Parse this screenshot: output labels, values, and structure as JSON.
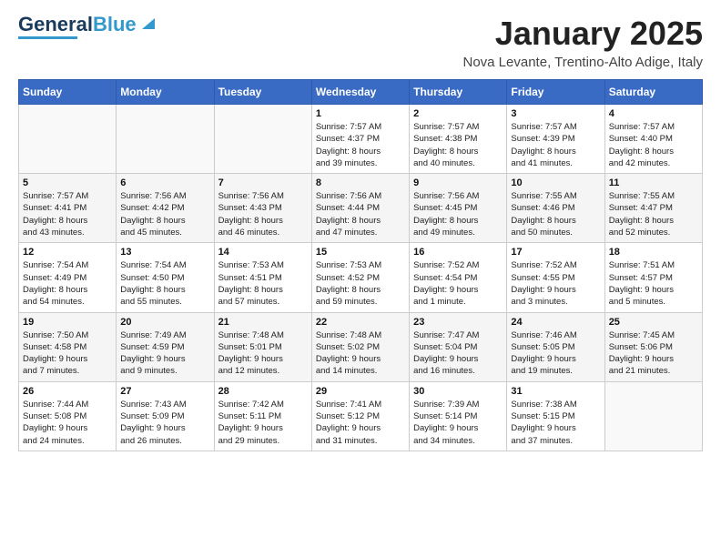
{
  "header": {
    "logo_line1": "General",
    "logo_line2": "Blue",
    "month": "January 2025",
    "location": "Nova Levante, Trentino-Alto Adige, Italy"
  },
  "weekdays": [
    "Sunday",
    "Monday",
    "Tuesday",
    "Wednesday",
    "Thursday",
    "Friday",
    "Saturday"
  ],
  "weeks": [
    [
      {
        "day": "",
        "info": ""
      },
      {
        "day": "",
        "info": ""
      },
      {
        "day": "",
        "info": ""
      },
      {
        "day": "1",
        "info": "Sunrise: 7:57 AM\nSunset: 4:37 PM\nDaylight: 8 hours\nand 39 minutes."
      },
      {
        "day": "2",
        "info": "Sunrise: 7:57 AM\nSunset: 4:38 PM\nDaylight: 8 hours\nand 40 minutes."
      },
      {
        "day": "3",
        "info": "Sunrise: 7:57 AM\nSunset: 4:39 PM\nDaylight: 8 hours\nand 41 minutes."
      },
      {
        "day": "4",
        "info": "Sunrise: 7:57 AM\nSunset: 4:40 PM\nDaylight: 8 hours\nand 42 minutes."
      }
    ],
    [
      {
        "day": "5",
        "info": "Sunrise: 7:57 AM\nSunset: 4:41 PM\nDaylight: 8 hours\nand 43 minutes."
      },
      {
        "day": "6",
        "info": "Sunrise: 7:56 AM\nSunset: 4:42 PM\nDaylight: 8 hours\nand 45 minutes."
      },
      {
        "day": "7",
        "info": "Sunrise: 7:56 AM\nSunset: 4:43 PM\nDaylight: 8 hours\nand 46 minutes."
      },
      {
        "day": "8",
        "info": "Sunrise: 7:56 AM\nSunset: 4:44 PM\nDaylight: 8 hours\nand 47 minutes."
      },
      {
        "day": "9",
        "info": "Sunrise: 7:56 AM\nSunset: 4:45 PM\nDaylight: 8 hours\nand 49 minutes."
      },
      {
        "day": "10",
        "info": "Sunrise: 7:55 AM\nSunset: 4:46 PM\nDaylight: 8 hours\nand 50 minutes."
      },
      {
        "day": "11",
        "info": "Sunrise: 7:55 AM\nSunset: 4:47 PM\nDaylight: 8 hours\nand 52 minutes."
      }
    ],
    [
      {
        "day": "12",
        "info": "Sunrise: 7:54 AM\nSunset: 4:49 PM\nDaylight: 8 hours\nand 54 minutes."
      },
      {
        "day": "13",
        "info": "Sunrise: 7:54 AM\nSunset: 4:50 PM\nDaylight: 8 hours\nand 55 minutes."
      },
      {
        "day": "14",
        "info": "Sunrise: 7:53 AM\nSunset: 4:51 PM\nDaylight: 8 hours\nand 57 minutes."
      },
      {
        "day": "15",
        "info": "Sunrise: 7:53 AM\nSunset: 4:52 PM\nDaylight: 8 hours\nand 59 minutes."
      },
      {
        "day": "16",
        "info": "Sunrise: 7:52 AM\nSunset: 4:54 PM\nDaylight: 9 hours\nand 1 minute."
      },
      {
        "day": "17",
        "info": "Sunrise: 7:52 AM\nSunset: 4:55 PM\nDaylight: 9 hours\nand 3 minutes."
      },
      {
        "day": "18",
        "info": "Sunrise: 7:51 AM\nSunset: 4:57 PM\nDaylight: 9 hours\nand 5 minutes."
      }
    ],
    [
      {
        "day": "19",
        "info": "Sunrise: 7:50 AM\nSunset: 4:58 PM\nDaylight: 9 hours\nand 7 minutes."
      },
      {
        "day": "20",
        "info": "Sunrise: 7:49 AM\nSunset: 4:59 PM\nDaylight: 9 hours\nand 9 minutes."
      },
      {
        "day": "21",
        "info": "Sunrise: 7:48 AM\nSunset: 5:01 PM\nDaylight: 9 hours\nand 12 minutes."
      },
      {
        "day": "22",
        "info": "Sunrise: 7:48 AM\nSunset: 5:02 PM\nDaylight: 9 hours\nand 14 minutes."
      },
      {
        "day": "23",
        "info": "Sunrise: 7:47 AM\nSunset: 5:04 PM\nDaylight: 9 hours\nand 16 minutes."
      },
      {
        "day": "24",
        "info": "Sunrise: 7:46 AM\nSunset: 5:05 PM\nDaylight: 9 hours\nand 19 minutes."
      },
      {
        "day": "25",
        "info": "Sunrise: 7:45 AM\nSunset: 5:06 PM\nDaylight: 9 hours\nand 21 minutes."
      }
    ],
    [
      {
        "day": "26",
        "info": "Sunrise: 7:44 AM\nSunset: 5:08 PM\nDaylight: 9 hours\nand 24 minutes."
      },
      {
        "day": "27",
        "info": "Sunrise: 7:43 AM\nSunset: 5:09 PM\nDaylight: 9 hours\nand 26 minutes."
      },
      {
        "day": "28",
        "info": "Sunrise: 7:42 AM\nSunset: 5:11 PM\nDaylight: 9 hours\nand 29 minutes."
      },
      {
        "day": "29",
        "info": "Sunrise: 7:41 AM\nSunset: 5:12 PM\nDaylight: 9 hours\nand 31 minutes."
      },
      {
        "day": "30",
        "info": "Sunrise: 7:39 AM\nSunset: 5:14 PM\nDaylight: 9 hours\nand 34 minutes."
      },
      {
        "day": "31",
        "info": "Sunrise: 7:38 AM\nSunset: 5:15 PM\nDaylight: 9 hours\nand 37 minutes."
      },
      {
        "day": "",
        "info": ""
      }
    ]
  ]
}
